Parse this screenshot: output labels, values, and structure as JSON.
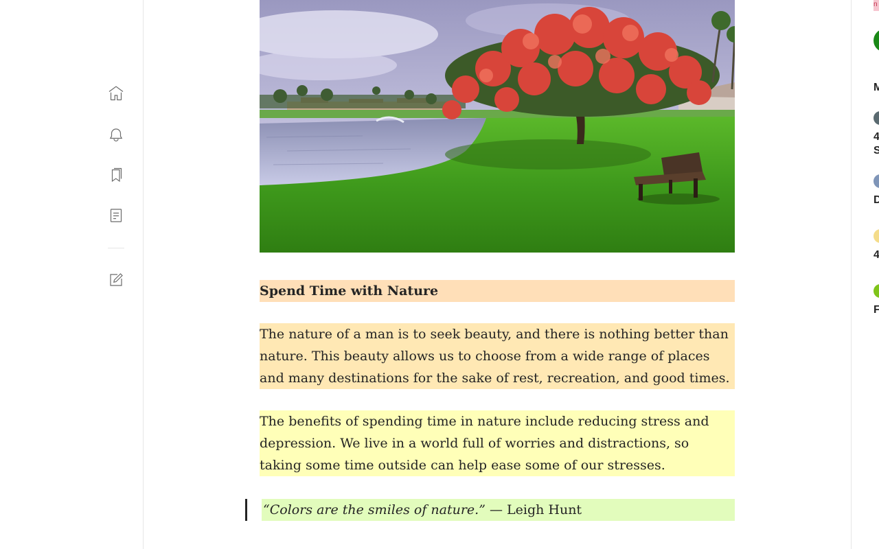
{
  "nav": {
    "items": [
      {
        "icon": "home-icon"
      },
      {
        "icon": "bell-icon"
      },
      {
        "icon": "bookmarks-icon"
      },
      {
        "icon": "stories-icon"
      },
      {
        "icon": "write-icon"
      }
    ]
  },
  "article": {
    "image": {
      "scene": [
        "sky",
        "lake",
        "palm trees",
        "flowering red tree",
        "grass lawn",
        "bench"
      ]
    },
    "heading": "Spend Time with Nature",
    "paragraphs": [
      "The nature of a man is to seek beauty, and there is nothing better than nature. This beauty allows us to choose from a wide range of places and many destinations for the sake of rest, recreation, and good times.",
      "The benefits of spending time in nature include reducing stress and depression. We live in a world full of worries and distractions, so taking some time outside can help ease some of our stresses."
    ],
    "quote": {
      "text": "“Colors are the smiles of nature.”",
      "attribution": "— Leigh Hunt"
    },
    "highlight_colors": {
      "heading": "#ffdfb8",
      "para1": "#ffe8b4",
      "para2": "#ffffb8",
      "quote": "#e2fcbc"
    }
  },
  "right_rail": {
    "badge": "n",
    "heading_initial": "M",
    "items": [
      {
        "text_lines": [
          "4",
          "S"
        ]
      },
      {
        "text_lines": [
          "D"
        ]
      },
      {
        "text_lines": [
          "4"
        ]
      },
      {
        "text_lines": [
          "F"
        ]
      }
    ]
  }
}
